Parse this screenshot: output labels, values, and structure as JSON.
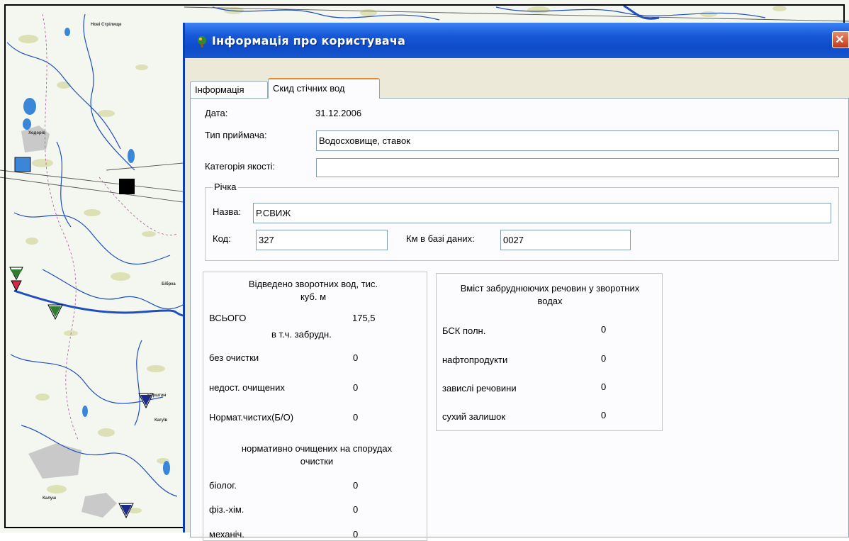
{
  "window": {
    "title": "Інформація про користувача",
    "close_symbol": "×"
  },
  "tabs": [
    {
      "label": "Інформація",
      "active": false
    },
    {
      "label": "Скид стічних вод",
      "active": true
    }
  ],
  "form": {
    "date_label": "Дата:",
    "date_value": "31.12.2006",
    "receiver_type_label": "Тип приймача:",
    "receiver_type_value": "Водосховище, ставок",
    "quality_category_label": "Категорія якості:",
    "quality_category_value": ""
  },
  "river": {
    "group_title": "Річка",
    "name_label": "Назва:",
    "name_value": "Р.СВИЖ",
    "code_label": "Код:",
    "code_value": "327",
    "km_label": "Км в базі даних:",
    "km_value": "0027"
  },
  "discharged": {
    "title": "Відведено зворотних вод,  тис. куб. м",
    "total_label": "ВСЬОГО",
    "total_value": "175,5",
    "incl_polluted_label": "в т.ч. забрудн.",
    "rows": [
      {
        "label": "без очистки",
        "value": "0"
      },
      {
        "label": "недост. очищених",
        "value": "0"
      },
      {
        "label": "Нормат.чистих(Б/О)",
        "value": "0"
      }
    ],
    "treated_title": "нормативно очищених на спорудах очистки",
    "treated_rows": [
      {
        "label": "біолог.",
        "value": "0"
      },
      {
        "label": "фіз.-хім.",
        "value": "0"
      },
      {
        "label": "механіч.",
        "value": "0"
      }
    ]
  },
  "pollutants": {
    "title": "Вміст забруднюючих речовин у зворотних водах",
    "rows": [
      {
        "label": "БСК полн.",
        "value": "0"
      },
      {
        "label": "нафтопродукти",
        "value": "0"
      },
      {
        "label": "завислі речовини",
        "value": "0"
      },
      {
        "label": "сухий залишок",
        "value": "0"
      }
    ]
  },
  "map": {
    "colors": {
      "water": "#1f4fbf",
      "terrain": "#d9dcab",
      "boundary": "#b04fa0",
      "road": "#555555",
      "lake": "#3a86d8"
    },
    "place_labels": [
      "Нові Стрілище",
      "Ходорів",
      "Бібрка",
      "Кагуїв",
      "Бурштин",
      "Калуш"
    ]
  },
  "icons": {
    "app_icon": "tree-icon",
    "close_icon": "close-icon"
  }
}
